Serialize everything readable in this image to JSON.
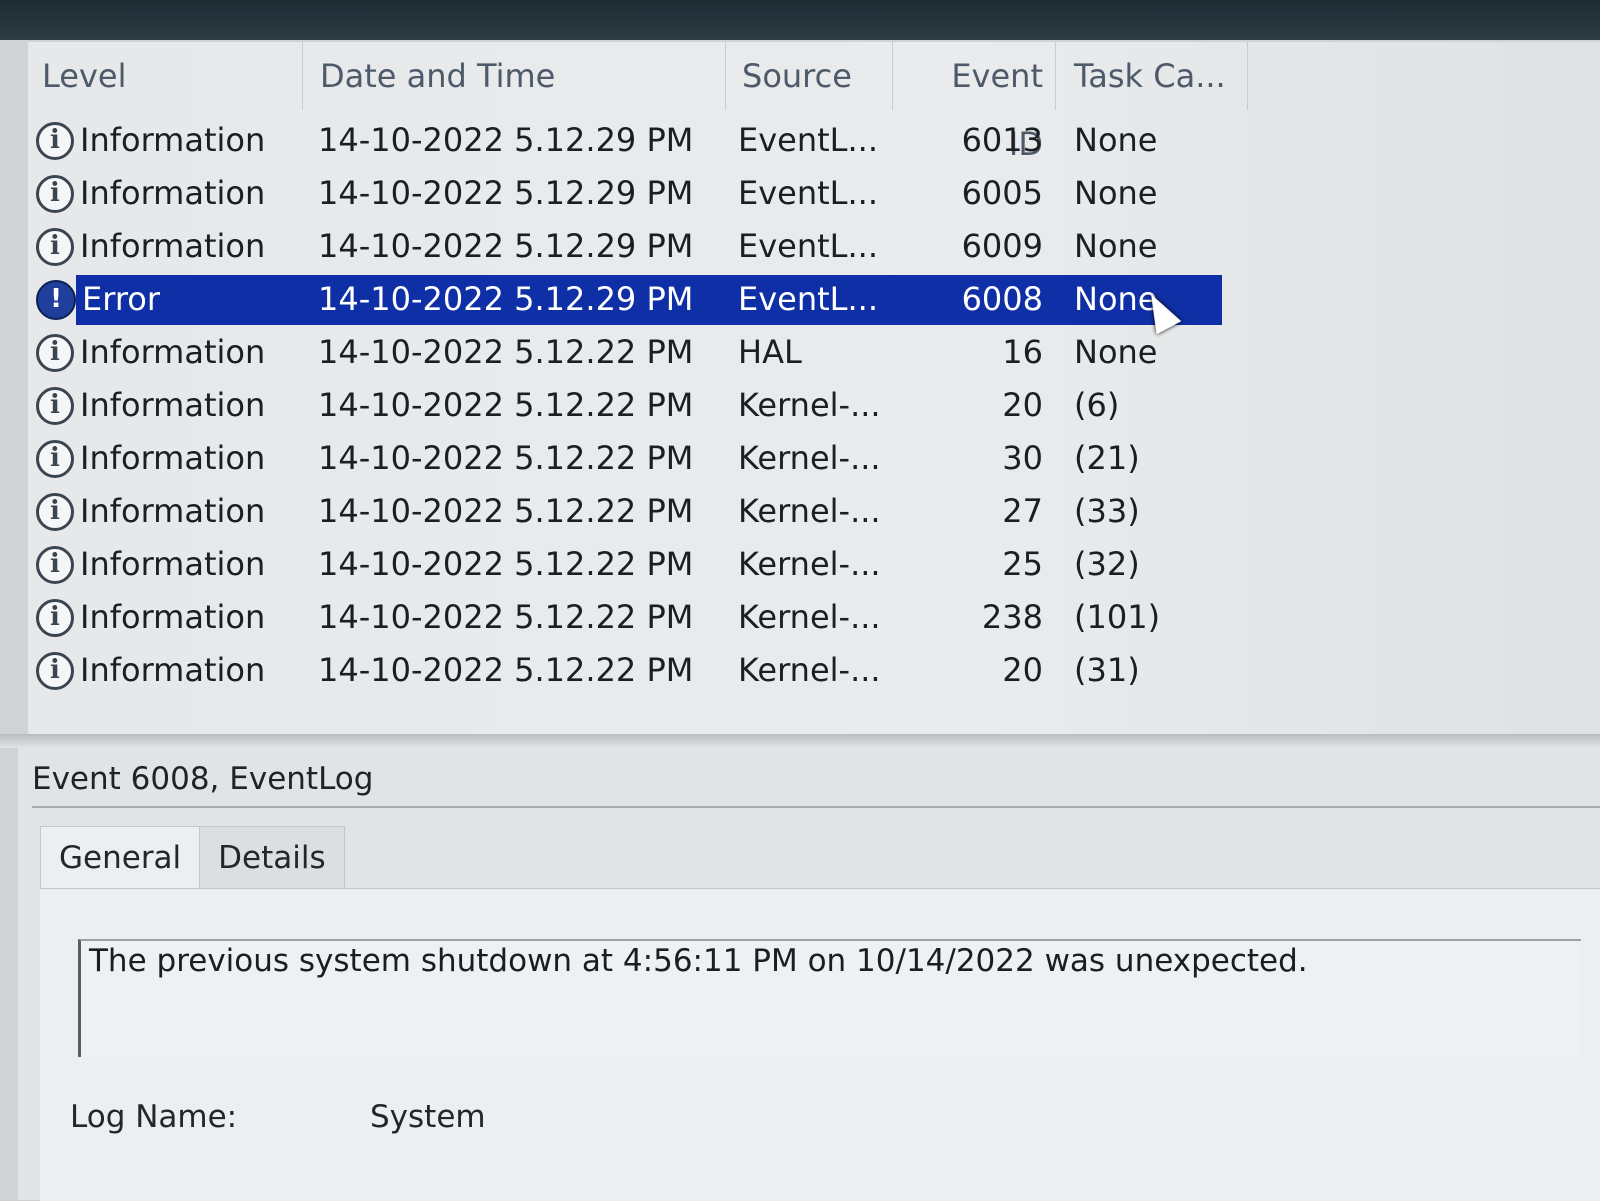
{
  "columns": {
    "level": "Level",
    "date_time": "Date and Time",
    "source": "Source",
    "event_id": "Event ID",
    "task_category": "Task Ca..."
  },
  "rows": [
    {
      "level": "Information",
      "date_time": "14-10-2022 5.12.29 PM",
      "source": "EventL...",
      "event_id": "6013",
      "task": "None",
      "type": "info"
    },
    {
      "level": "Information",
      "date_time": "14-10-2022 5.12.29 PM",
      "source": "EventL...",
      "event_id": "6005",
      "task": "None",
      "type": "info"
    },
    {
      "level": "Information",
      "date_time": "14-10-2022 5.12.29 PM",
      "source": "EventL...",
      "event_id": "6009",
      "task": "None",
      "type": "info"
    },
    {
      "level": "Error",
      "date_time": "14-10-2022 5.12.29 PM",
      "source": "EventL...",
      "event_id": "6008",
      "task": "None",
      "type": "error",
      "selected": true
    },
    {
      "level": "Information",
      "date_time": "14-10-2022 5.12.22 PM",
      "source": "HAL",
      "event_id": "16",
      "task": "None",
      "type": "info"
    },
    {
      "level": "Information",
      "date_time": "14-10-2022 5.12.22 PM",
      "source": "Kernel-...",
      "event_id": "20",
      "task": "(6)",
      "type": "info"
    },
    {
      "level": "Information",
      "date_time": "14-10-2022 5.12.22 PM",
      "source": "Kernel-...",
      "event_id": "30",
      "task": "(21)",
      "type": "info"
    },
    {
      "level": "Information",
      "date_time": "14-10-2022 5.12.22 PM",
      "source": "Kernel-...",
      "event_id": "27",
      "task": "(33)",
      "type": "info"
    },
    {
      "level": "Information",
      "date_time": "14-10-2022 5.12.22 PM",
      "source": "Kernel-...",
      "event_id": "25",
      "task": "(32)",
      "type": "info"
    },
    {
      "level": "Information",
      "date_time": "14-10-2022 5.12.22 PM",
      "source": "Kernel-...",
      "event_id": "238",
      "task": "(101)",
      "type": "info"
    },
    {
      "level": "Information",
      "date_time": "14-10-2022 5.12.22 PM",
      "source": "Kernel-...",
      "event_id": "20",
      "task": "(31)",
      "type": "info"
    }
  ],
  "icons": {
    "info": "information-icon",
    "error": "error-icon"
  },
  "colors": {
    "selection": "#0f2fa6",
    "error_icon": "#1f3f9a"
  },
  "details": {
    "title": "Event 6008, EventLog",
    "tabs": [
      "General",
      "Details"
    ],
    "active_tab": "General",
    "message": "The previous system shutdown at 4:56:11 PM on 10/14/2022 was unexpected.",
    "log_name_label": "Log Name:",
    "log_name_value": "System"
  }
}
